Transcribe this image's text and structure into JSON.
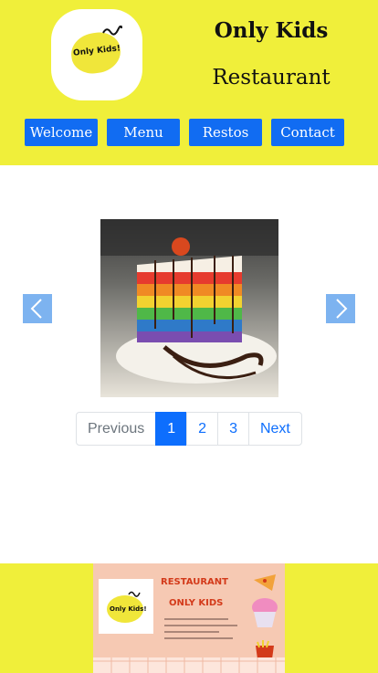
{
  "header": {
    "logo_text": "Only Kids!",
    "title": "Only Kids",
    "subtitle": "Restaurant"
  },
  "nav": {
    "items": [
      {
        "label": "Welcome"
      },
      {
        "label": "Menu"
      },
      {
        "label": "Restos"
      },
      {
        "label": "Contact"
      }
    ]
  },
  "carousel": {
    "image_subject": "rainbow-layer-cake-slice"
  },
  "pagination": {
    "previous": "Previous",
    "pages": [
      "1",
      "2",
      "3"
    ],
    "next": "Next",
    "active_page": "1"
  },
  "footer": {
    "flyer_heading_1": "RESTAURANT",
    "flyer_heading_2": "ONLY KIDS",
    "flyer_logo_text": "Only Kids!"
  },
  "colors": {
    "header_bg": "#f0ef3a",
    "nav_button": "#116cf2",
    "arrow": "#7db3f0",
    "pager_active": "#0d6efd",
    "flyer_bg": "#f6c9b3",
    "flyer_heading": "#d33a1a"
  }
}
